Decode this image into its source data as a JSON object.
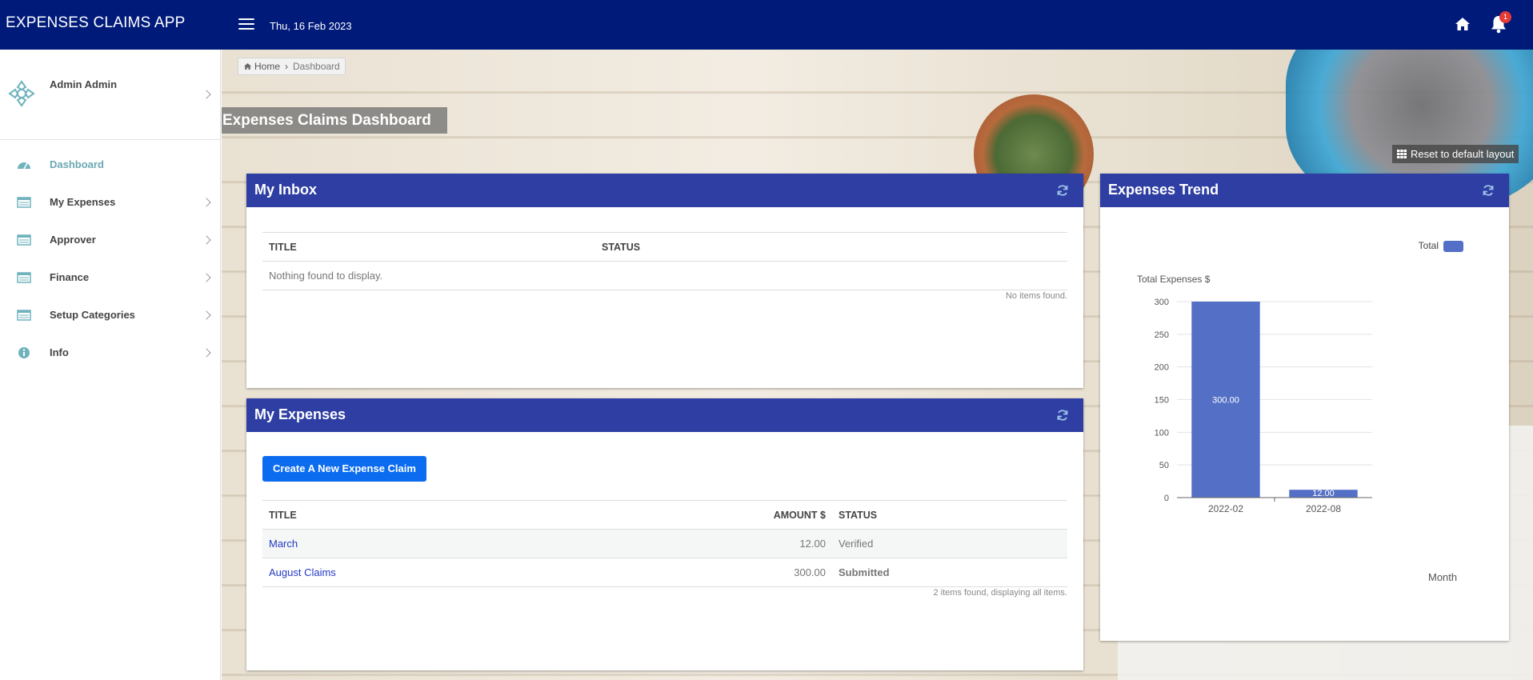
{
  "app": {
    "title": "EXPENSES CLAIMS APP",
    "date": "Thu, 16 Feb 2023",
    "notification_count": "1"
  },
  "sidebar": {
    "user_name": "Admin Admin",
    "items": [
      {
        "label": "Dashboard",
        "icon": "dashboard-icon",
        "active": true
      },
      {
        "label": "My Expenses",
        "icon": "list-icon"
      },
      {
        "label": "Approver",
        "icon": "list-icon"
      },
      {
        "label": "Finance",
        "icon": "list-icon"
      },
      {
        "label": "Setup Categories",
        "icon": "list-icon"
      },
      {
        "label": "Info",
        "icon": "info-icon"
      }
    ]
  },
  "breadcrumb": {
    "home": "Home",
    "current": "Dashboard"
  },
  "page": {
    "title": "Expenses Claims Dashboard",
    "reset_label": "Reset to default layout"
  },
  "inbox": {
    "title": "My Inbox",
    "columns": [
      "TITLE",
      "STATUS"
    ],
    "empty_text": "Nothing found to display.",
    "footer": "No items found."
  },
  "expenses": {
    "title": "My Expenses",
    "create_button": "Create A New Expense Claim",
    "columns": [
      "TITLE",
      "AMOUNT $",
      "STATUS"
    ],
    "rows": [
      {
        "title": "March",
        "amount": "12.00",
        "status": "Verified"
      },
      {
        "title": "August Claims",
        "amount": "300.00",
        "status": "Submitted"
      }
    ],
    "footer": "2 items found, displaying all items."
  },
  "trend": {
    "title": "Expenses Trend"
  },
  "chart_data": {
    "type": "bar",
    "categories": [
      "2022-02",
      "2022-08"
    ],
    "series": [
      {
        "name": "Total",
        "values": [
          300,
          12
        ],
        "color": "#5470c6"
      }
    ],
    "data_labels": [
      "300.00",
      "12.00"
    ],
    "ylabel": "Total Expenses $",
    "xlabel": "Month",
    "ylim": [
      0,
      300
    ],
    "yticks": [
      0,
      50,
      100,
      150,
      200,
      250,
      300
    ],
    "grid": true,
    "legend": "top-right"
  },
  "colors": {
    "topbar": "#001a7a",
    "panel_header": "#2e3ea3",
    "accent": "#0b6cf0",
    "submitted": "#f0a000",
    "bar": "#5470c6"
  }
}
